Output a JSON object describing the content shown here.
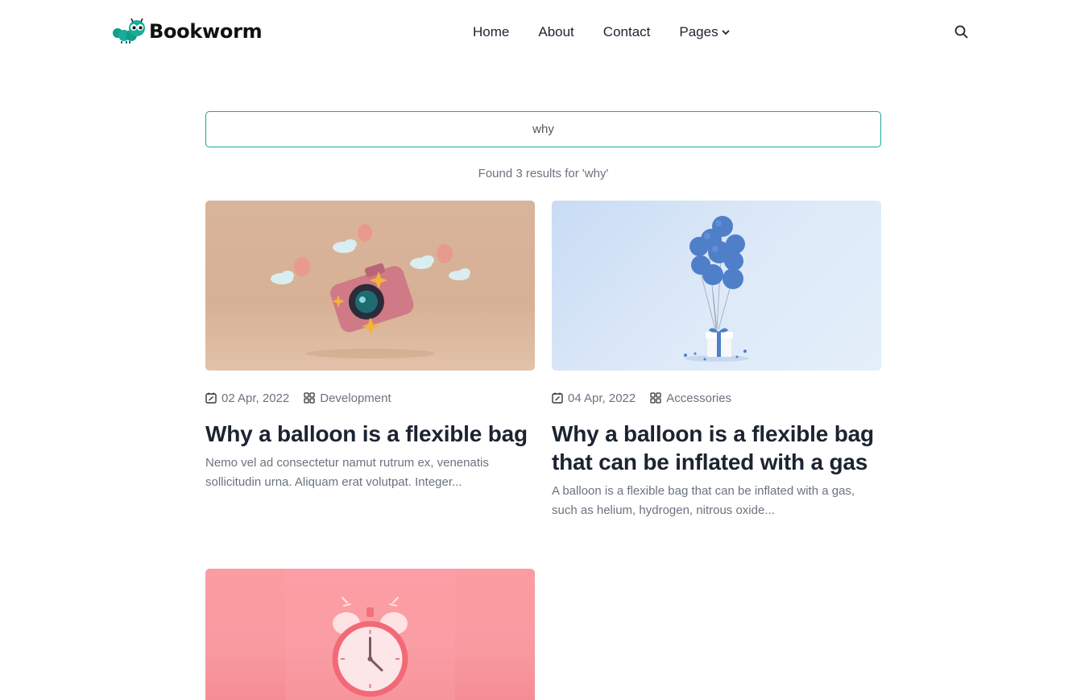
{
  "brand": {
    "name": "Bookworm",
    "icon": "caterpillar-logo-icon",
    "accent": "#1aa89a"
  },
  "nav": {
    "items": [
      {
        "label": "Home"
      },
      {
        "label": "About"
      },
      {
        "label": "Contact"
      },
      {
        "label": "Pages",
        "icon": "chevron-down-icon"
      }
    ],
    "search_icon": "search-icon"
  },
  "search": {
    "value": "why",
    "results_text": "Found 3 results for 'why'"
  },
  "posts": [
    {
      "image": "pink-camera-balloons-illustration",
      "date": "02 Apr, 2022",
      "category": "Development",
      "title": "Why a balloon is a flexible bag",
      "excerpt": "Nemo vel ad consectetur namut rutrum ex, venenatis sollicitudin urna. Aliquam erat volutpat. Integer..."
    },
    {
      "image": "blue-balloons-gift-illustration",
      "date": "04 Apr, 2022",
      "category": "Accessories",
      "title": "Why a balloon is a flexible bag that can be inflated with a gas",
      "excerpt": "A balloon is a flexible bag that can be inflated with a gas, such as helium, hydrogen, nitrous oxide..."
    },
    {
      "image": "pink-alarm-clock-illustration"
    }
  ]
}
